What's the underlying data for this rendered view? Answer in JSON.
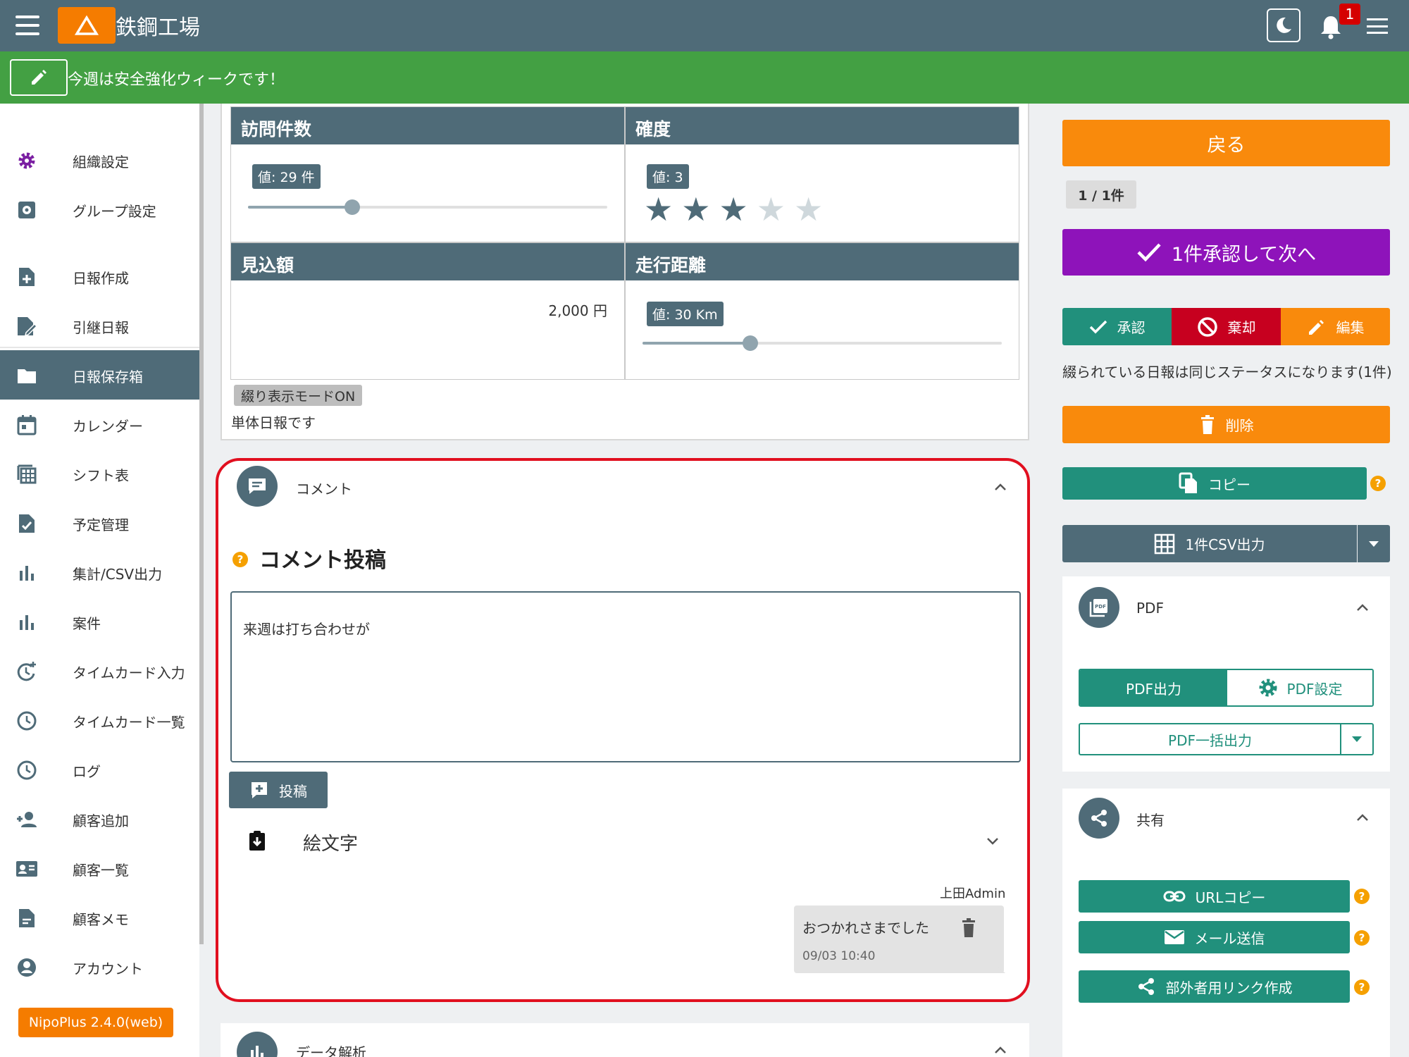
{
  "header": {
    "app_title": "鉄鋼工場",
    "notification_count": "1"
  },
  "announcement": {
    "text": "今週は安全強化ウィークです！"
  },
  "sidebar": {
    "items": [
      {
        "label": "組織設定",
        "icon": "gear-icon"
      },
      {
        "label": "グループ設定",
        "icon": "group-settings-icon"
      },
      {
        "label": "日報作成",
        "icon": "file-plus-icon"
      },
      {
        "label": "引継日報",
        "icon": "file-edit-icon"
      },
      {
        "label": "日報保存箱",
        "icon": "folder-icon"
      },
      {
        "label": "カレンダー",
        "icon": "calendar-icon"
      },
      {
        "label": "シフト表",
        "icon": "grid-icon"
      },
      {
        "label": "予定管理",
        "icon": "file-check-icon"
      },
      {
        "label": "集計/CSV出力",
        "icon": "bar-chart-icon"
      },
      {
        "label": "案件",
        "icon": "bar-chart-icon"
      },
      {
        "label": "タイムカード入力",
        "icon": "clock-plus-icon"
      },
      {
        "label": "タイムカード一覧",
        "icon": "clock-icon"
      },
      {
        "label": "ログ",
        "icon": "clock-icon"
      },
      {
        "label": "顧客追加",
        "icon": "person-add-icon"
      },
      {
        "label": "顧客一覧",
        "icon": "contact-card-icon"
      },
      {
        "label": "顧客メモ",
        "icon": "memo-icon"
      },
      {
        "label": "アカウント",
        "icon": "account-icon"
      }
    ],
    "active_index": 4,
    "version": "NipoPlus 2.4.0(web)"
  },
  "fields": {
    "visits": {
      "title": "訪問件数",
      "value_label": "値: 29 件",
      "level": 0.29
    },
    "certainty": {
      "title": "確度",
      "value_label": "値: 3",
      "rating": 3,
      "max": 5
    },
    "expected": {
      "title": "見込額",
      "amount": "2,000 円"
    },
    "distance": {
      "title": "走行距離",
      "value_label": "値: 30 Km",
      "level": 0.3
    }
  },
  "mode_chip": "綴り表示モードON",
  "single_text": "単体日報です",
  "comment": {
    "section_label": "コメント",
    "title": "コメント投稿",
    "input_value": "来週は打ち合わせが",
    "post_label": "投稿",
    "emoji_label": "絵文字",
    "author": "上田Admin",
    "message": "おつかれさまでした",
    "time": "09/03 10:40"
  },
  "next_section_label": "データ解析",
  "right": {
    "back_label": "戻る",
    "page_indicator": "1 / 1件",
    "approve_next_label": "1件承認して次へ",
    "approve_label": "承認",
    "reject_label": "棄却",
    "edit_label": "編集",
    "note": "綴られている日報は同じステータスになります(1件)",
    "delete_label": "削除",
    "copy_label": "コピー",
    "csv_label": "1件CSV出力",
    "pdf_section": "PDF",
    "pdf_output": "PDF出力",
    "pdf_settings": "PDF設定",
    "pdf_bulk": "PDF一括出力",
    "share_section": "共有",
    "url_copy": "URLコピー",
    "mail_send": "メール送信",
    "external_link": "部外者用リンク作成"
  },
  "colors": {
    "header": "#4f6b78",
    "announcement": "#43a043",
    "accent_orange": "#f98a0c",
    "accent_purple": "#8e13ba",
    "accent_teal": "#21907c",
    "reject_red": "#c7001f",
    "highlight_border": "#e10f1f"
  }
}
